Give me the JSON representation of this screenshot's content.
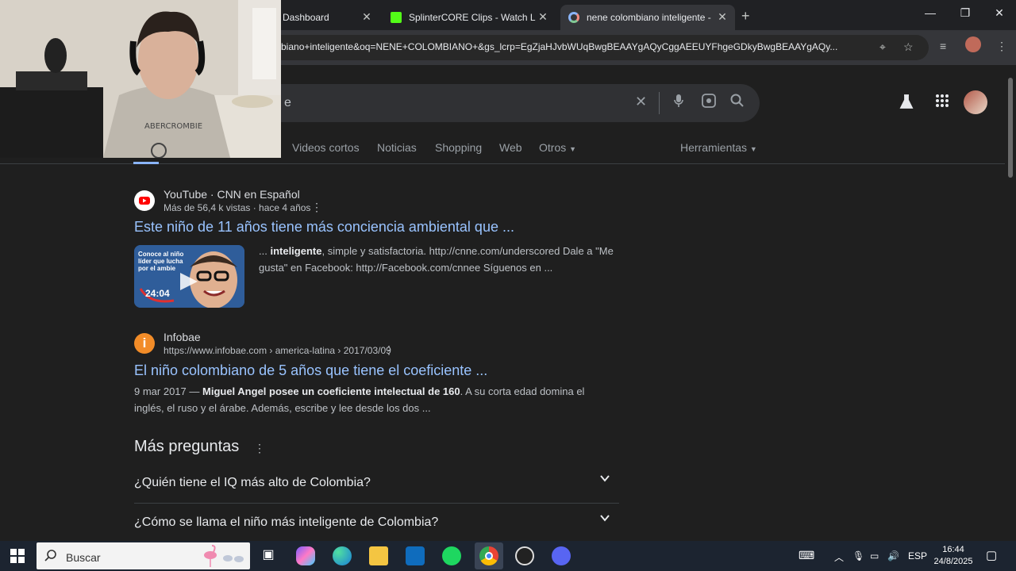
{
  "browser": {
    "tabs": [
      {
        "title": "Dashboard",
        "close": "✕"
      },
      {
        "title": "SplinterCORE Clips - Watch Live",
        "close": "✕"
      },
      {
        "title": "nene colombiano inteligente - ",
        "close": "✕",
        "active": true
      }
    ],
    "new_tab": "+",
    "window_controls": {
      "minimize": "—",
      "restore": "❐",
      "close": "✕"
    },
    "url": "biano+inteligente&oq=NENE+COLOMBIANO+&gs_lcrp=EgZjaHJvbWUqBwgBEAAYgAQyCggAEEUYFhgeGDkyBwgBEAAYgAQy..."
  },
  "search": {
    "query": "e",
    "clear_label": "✕",
    "nav_tabs": [
      "Videos cortos",
      "Noticias",
      "Shopping",
      "Web",
      "Otros",
      "Herramientas"
    ]
  },
  "results": [
    {
      "source": "YouTube · CNN en Español",
      "meta": "Más de 56,4 k vistas · hace 4 años",
      "title": "Este niño de 11 años tiene más conciencia ambiental que ...",
      "snippet_bold": "inteligente",
      "snippet_prefix": "... ",
      "snippet_line1_rest": ", simple y satisfactoria. http://cnne.com/underscored Dale a \"Me",
      "snippet_line2": "gusta\" en Facebook: http://Facebook.com/cnnee Síguenos en ...",
      "thumb_text": "Conoce al niño líder que lucha por el ambie",
      "duration": "24:04"
    },
    {
      "source": "Infobae",
      "meta": "https://www.infobae.com › america-latina › 2017/03/09",
      "title": "El niño colombiano de 5 años que tiene el coeficiente ...",
      "snippet_date": "9 mar 2017 — ",
      "snippet_bold": "Miguel Angel posee un coeficiente intelectual de 160",
      "snippet_line1_rest": ". A su corta edad domina el",
      "snippet_line2": "inglés, el ruso y el árabe. Además, escribe y lee desde los dos ..."
    }
  ],
  "paa": {
    "title": "Más preguntas",
    "questions": [
      "¿Quién tiene el IQ más alto de Colombia?",
      "¿Cómo se llama el niño más inteligente de Colombia?"
    ]
  },
  "taskbar": {
    "search_placeholder": "Buscar",
    "lang": "ESP",
    "time": "16:44",
    "date": "24/8/2025"
  },
  "colors": {
    "link": "#99c3ff",
    "background": "#1f1f1f",
    "youtube": "#ff0000",
    "infobae": "#f28c28"
  }
}
